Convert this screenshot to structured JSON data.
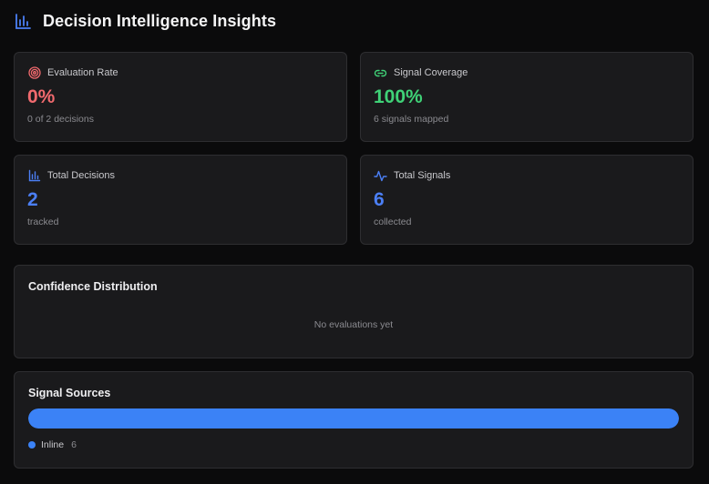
{
  "header": {
    "title": "Decision Intelligence Insights",
    "icon": "bar-chart-icon"
  },
  "stats": [
    {
      "icon": "target-icon",
      "label": "Evaluation Rate",
      "value": "0%",
      "sub": "0 of 2 decisions",
      "color": "#f16a6e"
    },
    {
      "icon": "link-icon",
      "label": "Signal Coverage",
      "value": "100%",
      "sub": "6 signals mapped",
      "color": "#3fd277"
    },
    {
      "icon": "bar-chart-icon",
      "label": "Total Decisions",
      "value": "2",
      "sub": "tracked",
      "color": "#4b7ff5"
    },
    {
      "icon": "activity-icon",
      "label": "Total Signals",
      "value": "6",
      "sub": "collected",
      "color": "#4b7ff5"
    }
  ],
  "confidence": {
    "title": "Confidence Distribution",
    "empty_text": "No evaluations yet"
  },
  "sources": {
    "title": "Signal Sources",
    "total": 6,
    "items": [
      {
        "name": "Inline",
        "count": "6",
        "value": 6,
        "color": "#3b82f6"
      }
    ]
  },
  "colors": {
    "accent_blue": "#4b7ff5",
    "bar_blue": "#3b82f6",
    "red": "#f16a6e",
    "green": "#3fd277"
  }
}
